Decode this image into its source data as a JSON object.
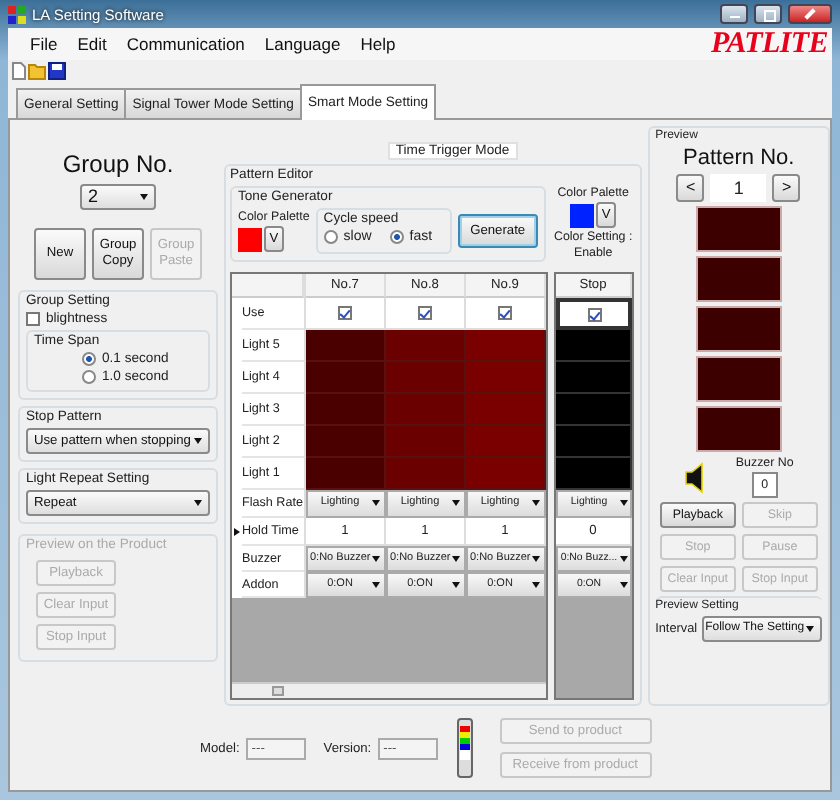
{
  "window": {
    "title": "LA Setting Software"
  },
  "menu": [
    "File",
    "Edit",
    "Communication",
    "Language",
    "Help"
  ],
  "logo": "PATLITE",
  "tabs": [
    {
      "label": "General Setting",
      "selected": false
    },
    {
      "label": "Signal Tower Mode Setting",
      "selected": false
    },
    {
      "label": "Smart Mode Setting",
      "selected": true
    }
  ],
  "mode_label": "Time Trigger Mode",
  "left": {
    "group_no_label": "Group No.",
    "group_no": "2",
    "group_buttons": [
      {
        "label": "New",
        "disabled": false
      },
      {
        "label": "Group Copy",
        "disabled": false
      },
      {
        "label": "Group Paste",
        "disabled": true
      }
    ],
    "group_setting": {
      "title": "Group Setting",
      "brightness": {
        "label": "blightness",
        "checked": false
      },
      "time_span": {
        "title": "Time Span",
        "options": [
          {
            "label": "0.1 second",
            "selected": true
          },
          {
            "label": "1.0 second",
            "selected": false
          }
        ]
      }
    },
    "stop_pattern": {
      "title": "Stop Pattern",
      "value": "Use pattern when stopping"
    },
    "light_repeat": {
      "title": "Light Repeat Setting",
      "value": "Repeat"
    },
    "product_preview": {
      "title": "Preview on the Product",
      "disabled": true,
      "buttons": [
        "Playback",
        "Clear Input",
        "Stop Input"
      ]
    }
  },
  "editor": {
    "title": "Pattern Editor",
    "tone_generator": {
      "title": "Tone Generator",
      "palette_label": "Color Palette",
      "color": "#ff0000",
      "palette_button": "V",
      "cycle_speed": {
        "title": "Cycle speed",
        "options": [
          {
            "label": "slow",
            "selected": false
          },
          {
            "label": "fast",
            "selected": true
          }
        ]
      },
      "generate": "Generate"
    },
    "palette": {
      "label": "Color Palette",
      "color": "#0022ff",
      "button": "V",
      "setting_label": "Color Setting :",
      "setting_value": "Enable"
    },
    "table": {
      "rows": [
        {
          "label": "Use",
          "current": false
        },
        {
          "label": "Light 5",
          "current": false
        },
        {
          "label": "Light 4",
          "current": false
        },
        {
          "label": "Light 3",
          "current": false
        },
        {
          "label": "Light 2",
          "current": false
        },
        {
          "label": "Light 1",
          "current": false
        },
        {
          "label": "Flash Rate",
          "current": false
        },
        {
          "label": "Hold Time",
          "current": true
        },
        {
          "label": "Buzzer",
          "current": false
        },
        {
          "label": "Addon",
          "current": false
        }
      ],
      "columns": [
        {
          "label": "No.7",
          "use": true,
          "lights": [
            {
              "color": "#4b0000"
            },
            {
              "color": "#4b0000"
            },
            {
              "color": "#4b0000"
            },
            {
              "color": "#4b0000"
            },
            {
              "color": "#4b0000"
            }
          ],
          "flash_rate": "Lighting",
          "hold_time": "1",
          "buzzer": "0:No Buzzer",
          "addon": "0:ON"
        },
        {
          "label": "No.8",
          "use": true,
          "lights": [
            {
              "color": "#6a0000"
            },
            {
              "color": "#6a0000"
            },
            {
              "color": "#6a0000"
            },
            {
              "color": "#6a0000"
            },
            {
              "color": "#6a0000"
            }
          ],
          "flash_rate": "Lighting",
          "hold_time": "1",
          "buzzer": "0:No Buzzer",
          "addon": "0:ON"
        },
        {
          "label": "No.9",
          "use": true,
          "lights": [
            {
              "color": "#7a0000"
            },
            {
              "color": "#7a0000"
            },
            {
              "color": "#7a0000"
            },
            {
              "color": "#7a0000"
            },
            {
              "color": "#7a0000"
            }
          ],
          "flash_rate": "Lighting",
          "hold_time": "1",
          "buzzer": "0:No Buzzer",
          "addon": "0:ON"
        }
      ],
      "stop_column": {
        "label": "Stop",
        "use": true,
        "lights": [
          {
            "color": "#000000"
          },
          {
            "color": "#000000"
          },
          {
            "color": "#000000"
          },
          {
            "color": "#000000"
          },
          {
            "color": "#000000"
          }
        ],
        "flash_rate": "Lighting",
        "hold_time": "0",
        "buzzer": "0:No Buzz...",
        "addon": "0:ON"
      }
    }
  },
  "preview": {
    "title": "Preview",
    "pattern_label": "Pattern No.",
    "prev": "<",
    "pattern_no": "1",
    "next": ">",
    "lights": [
      {
        "color": "#3d0000"
      },
      {
        "color": "#3d0000"
      },
      {
        "color": "#3d0000"
      },
      {
        "color": "#3d0000"
      },
      {
        "color": "#3d0000"
      }
    ],
    "buzzer_label": "Buzzer No",
    "buzzer_no": "0",
    "buttons": [
      {
        "label": "Playback",
        "disabled": false
      },
      {
        "label": "Skip",
        "disabled": true
      },
      {
        "label": "Stop",
        "disabled": true
      },
      {
        "label": "Pause",
        "disabled": true
      },
      {
        "label": "Clear Input",
        "disabled": true
      },
      {
        "label": "Stop Input",
        "disabled": true
      }
    ],
    "setting": {
      "title": "Preview Setting",
      "interval_label": "Interval",
      "interval": "Follow The Setting"
    }
  },
  "bottom": {
    "model_label": "Model:",
    "model": "---",
    "version_label": "Version:",
    "version": "---",
    "buttons": [
      {
        "label": "Send to product",
        "disabled": true
      },
      {
        "label": "Receive from product",
        "disabled": true
      }
    ]
  }
}
